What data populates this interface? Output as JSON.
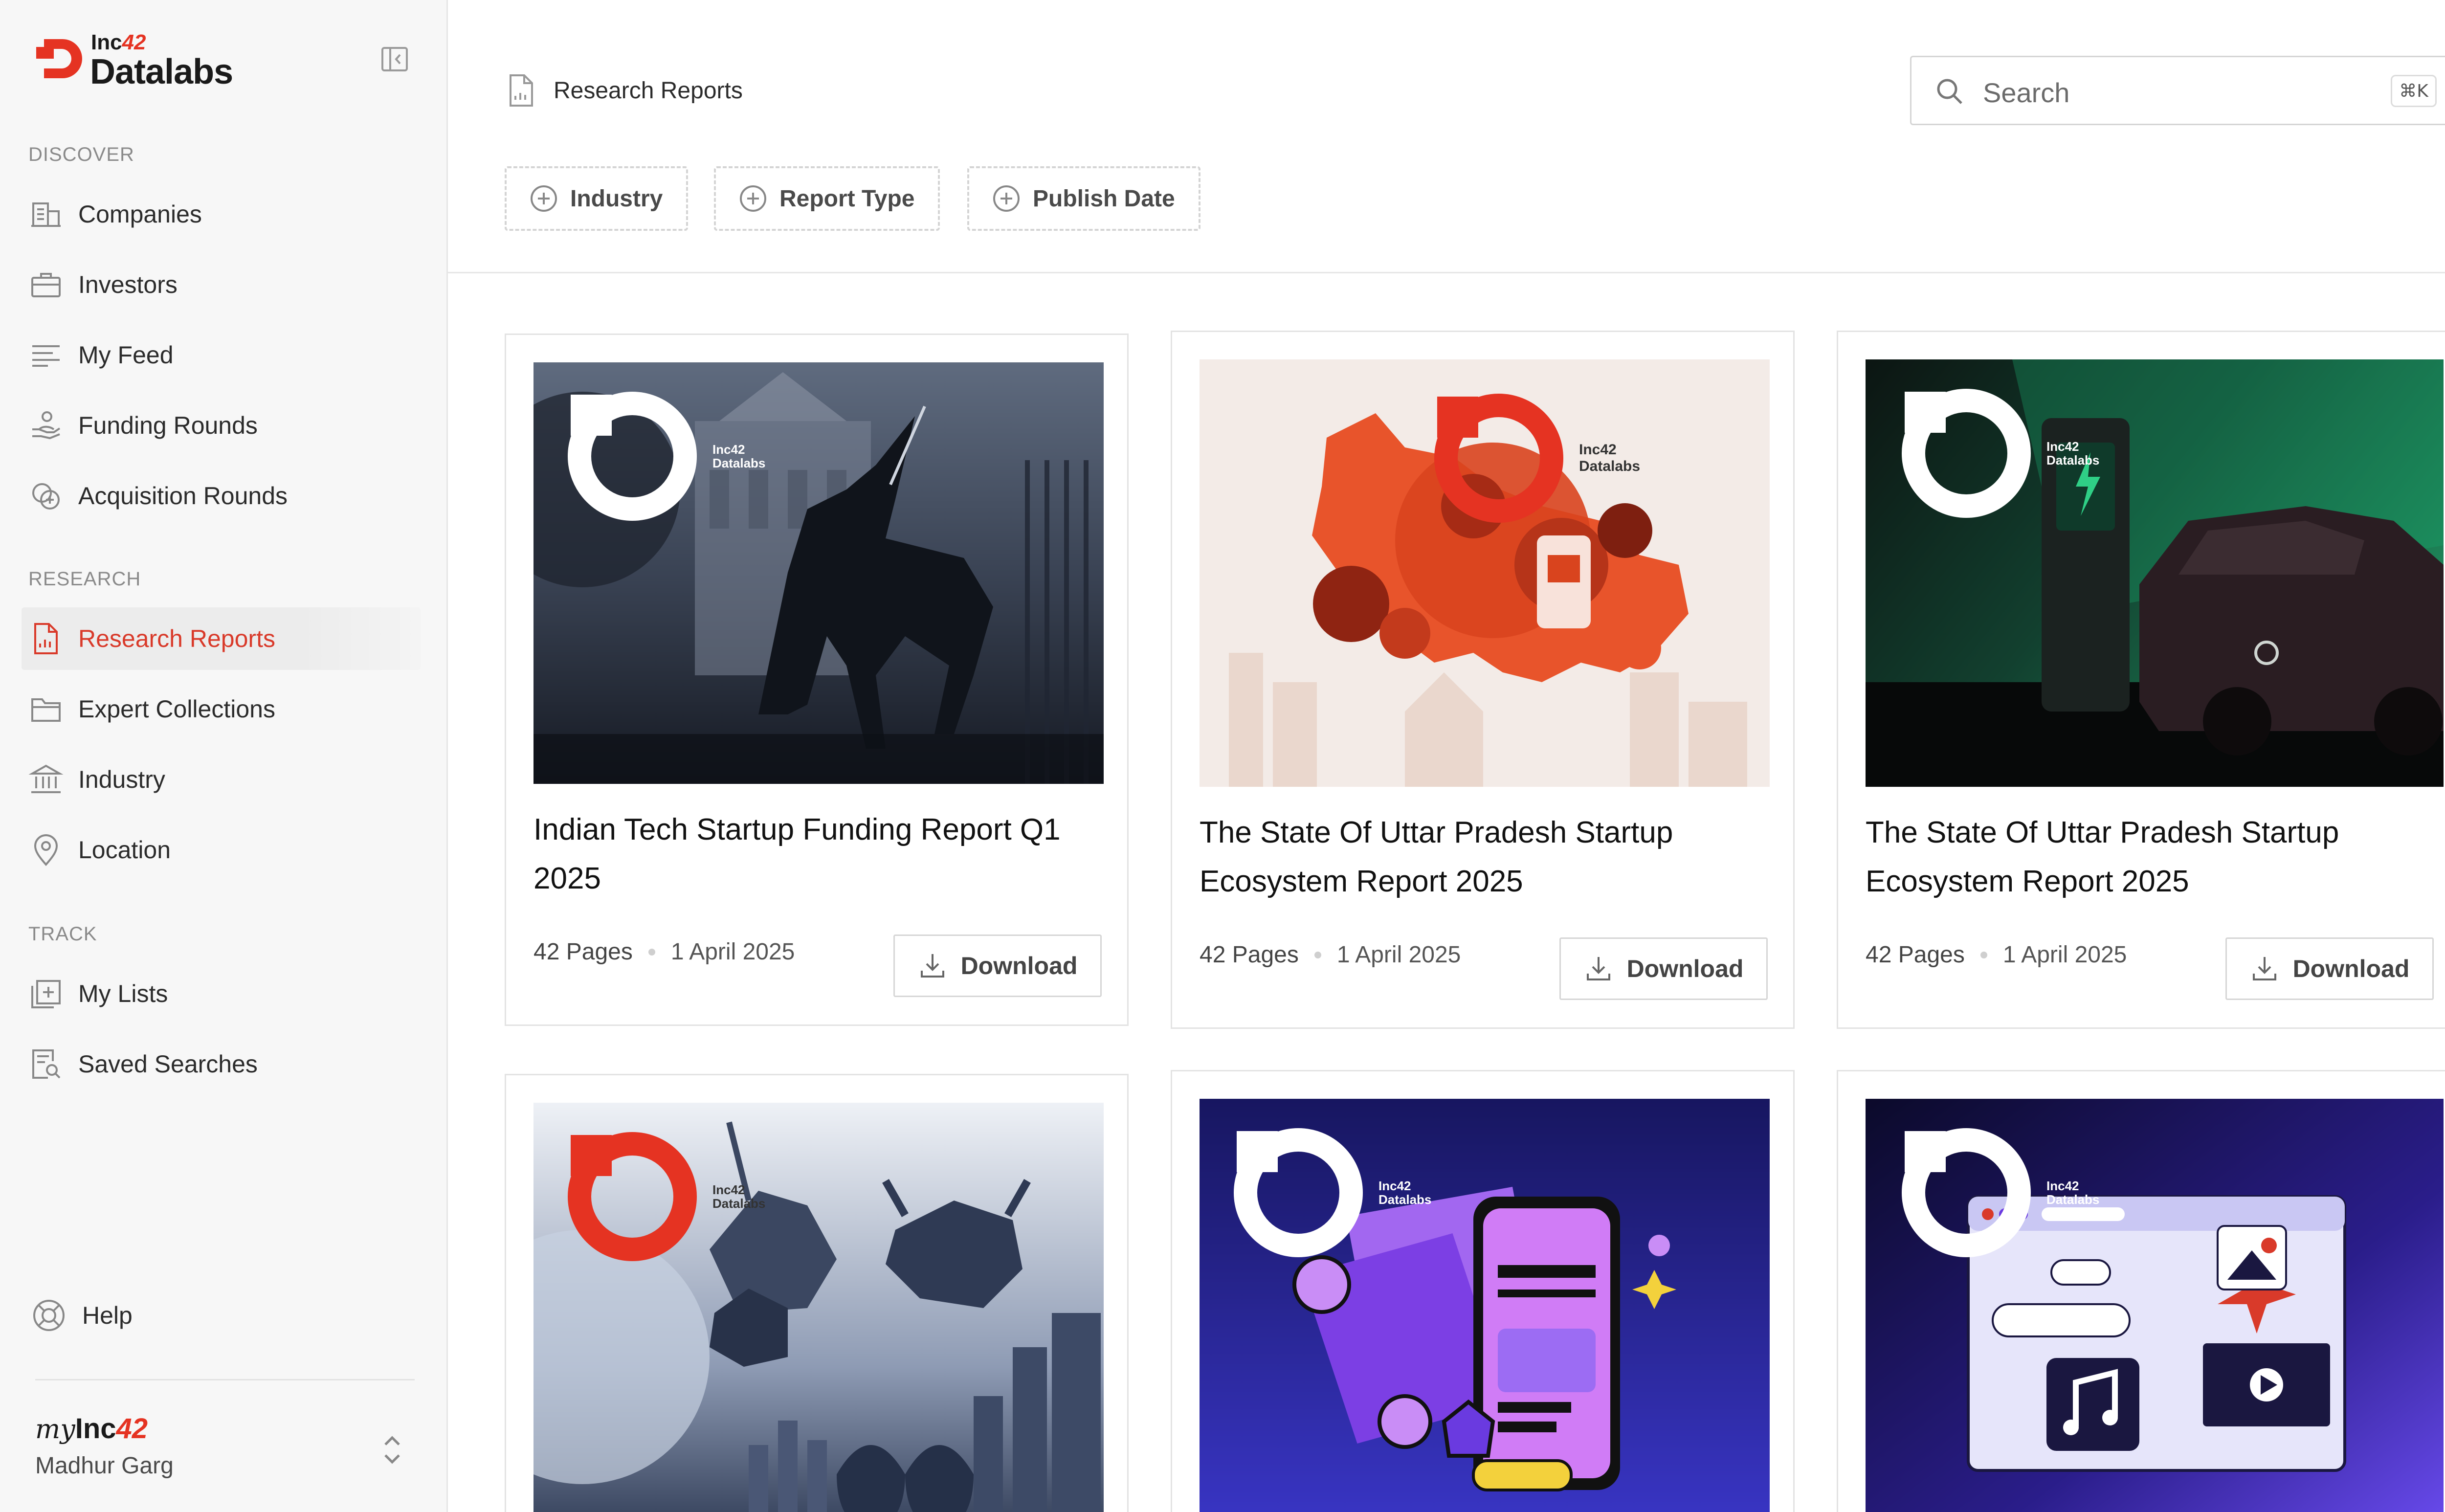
{
  "brand": {
    "inc": "Inc",
    "inc_accent": "42",
    "title": "Datalabs"
  },
  "sidebar": {
    "sections": [
      {
        "label": "DISCOVER"
      },
      {
        "label": "RESEARCH"
      },
      {
        "label": "TRACK"
      }
    ],
    "items": [
      {
        "label": "Companies",
        "icon": "building-icon"
      },
      {
        "label": "Investors",
        "icon": "briefcase-icon"
      },
      {
        "label": "My Feed",
        "icon": "feed-lines-icon"
      },
      {
        "label": "Funding Rounds",
        "icon": "hand-coin-icon"
      },
      {
        "label": "Acquisition Rounds",
        "icon": "coins-plus-icon"
      },
      {
        "label": "Research Reports",
        "icon": "report-doc-icon",
        "active": true
      },
      {
        "label": "Expert Collections",
        "icon": "folder-icon"
      },
      {
        "label": "Industry",
        "icon": "bank-icon"
      },
      {
        "label": "Location",
        "icon": "map-pin-icon"
      },
      {
        "label": "My Lists",
        "icon": "list-plus-icon"
      },
      {
        "label": "Saved Searches",
        "icon": "doc-search-icon"
      }
    ],
    "help_label": "Help",
    "account": {
      "my": "my",
      "inc": "Inc",
      "inc_accent": "42",
      "user_name": "Madhur Garg"
    }
  },
  "header": {
    "breadcrumb": "Research Reports",
    "search": {
      "placeholder": "Search",
      "shortcut": "⌘K"
    },
    "filters": [
      {
        "label": "Industry"
      },
      {
        "label": "Report Type"
      },
      {
        "label": "Publish Date"
      }
    ]
  },
  "reports": [
    {
      "title": "Indian Tech Startup Funding Report Q1 2025",
      "pages": "42 Pages",
      "date": "1 April 2025",
      "download_label": "Download",
      "image": "unicorn-city"
    },
    {
      "title": "The State Of Uttar Pradesh Startup Ecosystem Report 2025",
      "pages": "42 Pages",
      "date": "1 April 2025",
      "download_label": "Download",
      "image": "up-map"
    },
    {
      "title": "The State Of Uttar Pradesh Startup Ecosystem Report 2025",
      "pages": "42 Pages",
      "date": "1 April 2025",
      "download_label": "Download",
      "image": "ev-charging"
    },
    {
      "title": "",
      "pages": "",
      "date": "",
      "download_label": "",
      "image": "bull-bear-unicorn"
    },
    {
      "title": "",
      "pages": "",
      "date": "",
      "download_label": "",
      "image": "fintech-phone"
    },
    {
      "title": "",
      "pages": "",
      "date": "",
      "download_label": "",
      "image": "music-ai-window"
    }
  ],
  "thumb_badge": {
    "line1": "Inc42",
    "line2": "Datalabs"
  },
  "colors": {
    "accent": "#e53322",
    "active_text": "#d93a2a",
    "sidebar_bg": "#f7f7f7"
  }
}
